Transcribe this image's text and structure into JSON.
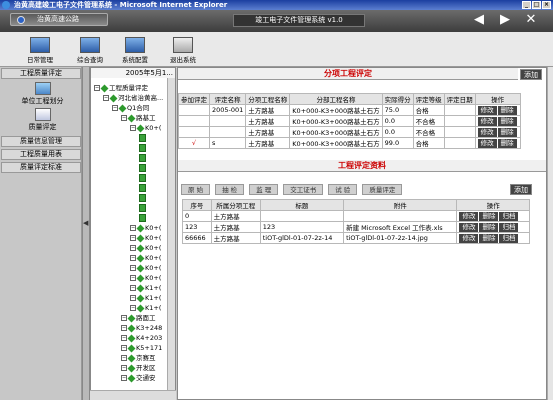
{
  "window": {
    "title": "治黄高建竣工电子文件管理系统 - Microsoft Internet Explorer",
    "controls": [
      "_",
      "□",
      "×"
    ]
  },
  "banner": {
    "site": "治黄高速公路",
    "system": "竣工电子文件管理系统 v1.0",
    "back": "◀",
    "forward": "▶",
    "close": "✕"
  },
  "toolbar": [
    {
      "label": "日常管理"
    },
    {
      "label": "综合查询"
    },
    {
      "label": "系统配置"
    },
    {
      "label": "退出系统"
    }
  ],
  "leftnav": {
    "sections": [
      {
        "label": "工程质量评定"
      }
    ],
    "items": [
      {
        "label": "单位工程划分"
      },
      {
        "label": "质量评定"
      }
    ],
    "links": [
      {
        "label": "质量信息管理"
      },
      {
        "label": "工程质量用表"
      },
      {
        "label": "质量评定标准"
      }
    ]
  },
  "tree": {
    "header": "2005年5月1...",
    "nodes": [
      {
        "label": "工程质量评定",
        "indent": 0,
        "type": "root"
      },
      {
        "label": "河北省治黄高...",
        "indent": 1,
        "type": "node"
      },
      {
        "label": "Q1合同",
        "indent": 2,
        "type": "node"
      },
      {
        "label": "路基工",
        "indent": 3,
        "type": "node"
      },
      {
        "label": "K0+(",
        "indent": 4,
        "type": "node"
      },
      {
        "label": "",
        "indent": 5,
        "type": "page"
      },
      {
        "label": "",
        "indent": 5,
        "type": "page"
      },
      {
        "label": "",
        "indent": 5,
        "type": "page"
      },
      {
        "label": "",
        "indent": 5,
        "type": "page"
      },
      {
        "label": "",
        "indent": 5,
        "type": "page"
      },
      {
        "label": "",
        "indent": 5,
        "type": "page"
      },
      {
        "label": "",
        "indent": 5,
        "type": "page"
      },
      {
        "label": "",
        "indent": 5,
        "type": "page"
      },
      {
        "label": "",
        "indent": 5,
        "type": "page"
      },
      {
        "label": "K0+(",
        "indent": 4,
        "type": "node"
      },
      {
        "label": "K0+(",
        "indent": 4,
        "type": "node"
      },
      {
        "label": "K0+(",
        "indent": 4,
        "type": "node"
      },
      {
        "label": "K0+(",
        "indent": 4,
        "type": "node"
      },
      {
        "label": "K0+(",
        "indent": 4,
        "type": "node"
      },
      {
        "label": "K0+(",
        "indent": 4,
        "type": "node"
      },
      {
        "label": "K1+(",
        "indent": 4,
        "type": "node"
      },
      {
        "label": "K1+(",
        "indent": 4,
        "type": "node"
      },
      {
        "label": "K1+(",
        "indent": 4,
        "type": "node"
      },
      {
        "label": "路面工",
        "indent": 3,
        "type": "node"
      },
      {
        "label": "K3+248",
        "indent": 3,
        "type": "node"
      },
      {
        "label": "K4+203",
        "indent": 3,
        "type": "node"
      },
      {
        "label": "K5+171",
        "indent": 3,
        "type": "node"
      },
      {
        "label": "京赛互",
        "indent": 3,
        "type": "node"
      },
      {
        "label": "开发区",
        "indent": 3,
        "type": "node"
      },
      {
        "label": "交通安",
        "indent": 3,
        "type": "node"
      }
    ]
  },
  "eval": {
    "title": "分项工程评定",
    "add": "添加",
    "headers": [
      "参加评定",
      "评定名称",
      "分项工程名称",
      "分部工程名称",
      "实际得分",
      "评定等级",
      "评定日期",
      "操作"
    ],
    "rows": [
      {
        "check": "",
        "name": "2005-001",
        "item": "土方路基",
        "part": "K0+000-K3+000路基土石方",
        "score": "75.0",
        "grade": "合格",
        "date": ""
      },
      {
        "check": "",
        "name": "",
        "item": "土方路基",
        "part": "K0+000-K3+000路基土石方",
        "score": "0.0",
        "grade": "不合格",
        "date": ""
      },
      {
        "check": "",
        "name": "",
        "item": "土方路基",
        "part": "K0+000-K3+000路基土石方",
        "score": "0.0",
        "grade": "不合格",
        "date": ""
      },
      {
        "check": "√",
        "name": "s",
        "item": "土方路基",
        "part": "K0+000-K3+000路基土石方",
        "score": "99.0",
        "grade": "合格",
        "date": ""
      }
    ],
    "ops": [
      "修改",
      "删除"
    ]
  },
  "materials": {
    "title": "工程评定资料",
    "add": "添加",
    "tabs": [
      "原 始",
      "抽 检",
      "监 理",
      "交工证书",
      "试 验",
      "质量评定"
    ],
    "headers": [
      "序号",
      "所属分项工程",
      "标题",
      "附件",
      "操作"
    ],
    "rows": [
      {
        "no": "0",
        "item": "土方路基",
        "title": "",
        "file": ""
      },
      {
        "no": "123",
        "item": "土方路基",
        "title": "123",
        "file": "新建 Microsoft Excel 工作表.xls"
      },
      {
        "no": "66666",
        "item": "土方路基",
        "title": "tiOT-glDl-01-07-2z-14",
        "file": "tiOT-glDl-01-07-2z-14.jpg"
      }
    ],
    "ops": [
      "修改",
      "删除",
      "归档"
    ]
  },
  "colors": {
    "accent": "#cc0000",
    "button": "#444444",
    "titlebar": "#1b3fa0"
  }
}
